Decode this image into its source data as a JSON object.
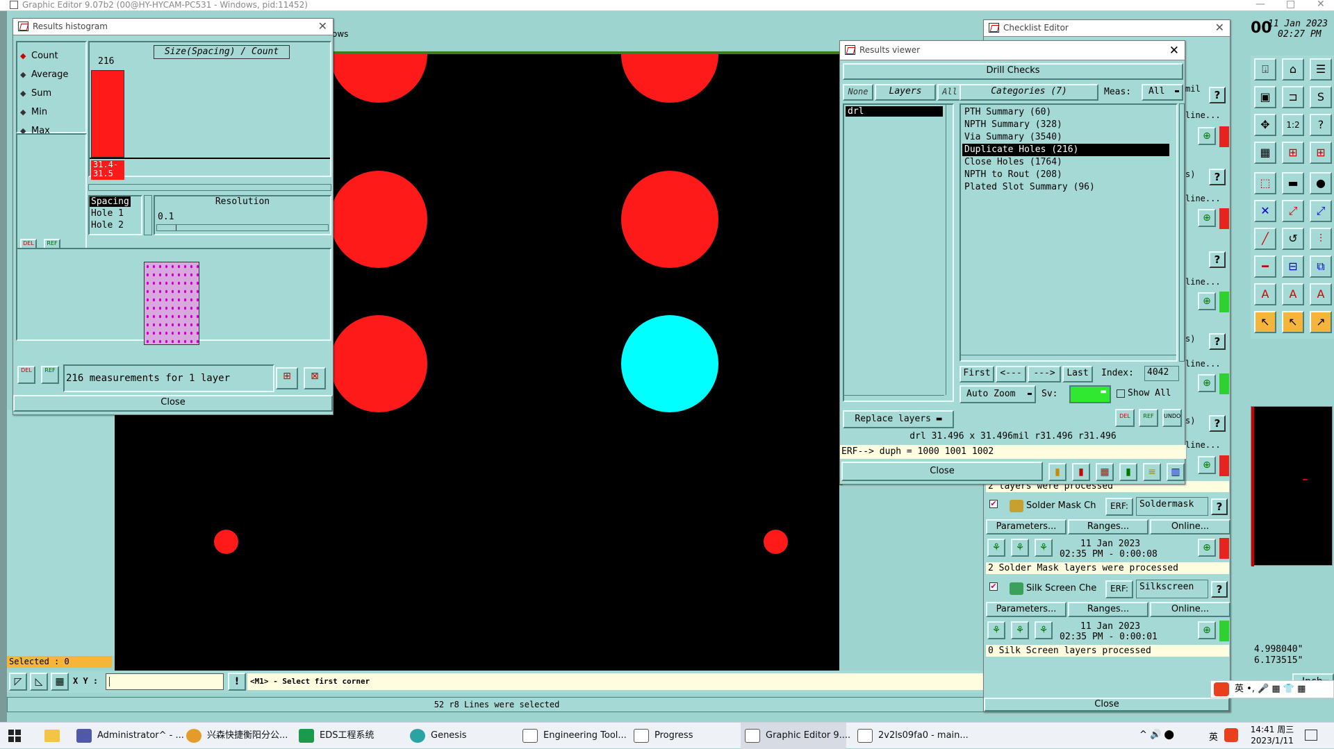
{
  "app_title": "Graphic Editor 9.07b2 (00@HY-HYCAM-PC531 - Windows, pid:11452)",
  "datetime": {
    "date": "11 Jan 2023",
    "time": "02:27 PM",
    "partial": "00"
  },
  "main_menu_partial": "ows",
  "histogram": {
    "title": "Results histogram",
    "options": [
      "Count",
      "Average",
      "Sum",
      "Min",
      "Max"
    ],
    "selected_option": "Count",
    "axis_title": "Size(Spacing) / Count",
    "bar_count": "216",
    "bar_label": "31.4- 31.5",
    "spacing_header": "Spacing",
    "spacing_items": [
      "Hole 1",
      "Hole 2"
    ],
    "resolution_label": "Resolution",
    "resolution_value": "0.1",
    "summary": "216 measurements for 1 layer",
    "close": "Close",
    "del": "DEL",
    "ref": "REF",
    "chart_data": {
      "type": "bar",
      "categories": [
        "31.4-31.5"
      ],
      "values": [
        216
      ],
      "title": "Size(Spacing) / Count",
      "xlabel": "",
      "ylabel": ""
    }
  },
  "results_viewer": {
    "title": "Results viewer",
    "section": "Drill Checks",
    "layer_tabs": [
      "None",
      "Layers",
      "All"
    ],
    "layers": [
      "drl"
    ],
    "categories_header": "Categories (7)",
    "meas_label": "Meas:",
    "meas_value": "All",
    "categories": [
      "PTH Summary (60)",
      "NPTH Summary (328)",
      "Via Summary (3540)",
      "Duplicate Holes (216)",
      "Close Holes (1764)",
      "NPTH to Rout (208)",
      "Plated Slot Summary (96)"
    ],
    "selected_category": "Duplicate Holes (216)",
    "nav": {
      "first": "First",
      "prev": "<---",
      "next": "--->",
      "last": "Last",
      "index_label": "Index:",
      "index_value": "4042"
    },
    "auto_zoom": "Auto Zoom",
    "sv_label": "Sv:",
    "show_all": "Show All",
    "replace_layers": "Replace layers",
    "info_line": "drl 31.496 x 31.496mil  r31.496  r31.496",
    "erf_line": "ERF--> duph = 1000 1001 1002",
    "close": "Close"
  },
  "checklist": {
    "title": "Checklist Editor",
    "partial_labels": [
      "mil",
      "line...",
      "s)",
      "line...",
      "line...",
      "s)",
      "line...",
      "s)",
      "line..."
    ],
    "processed_partial": "2 layers were processed",
    "items": [
      {
        "name": "Solder Mask Ch",
        "erf_label": "ERF:",
        "erf_value": "Soldermask",
        "params": "Parameters...",
        "ranges": "Ranges...",
        "online": "Online...",
        "date": "11 Jan 2023",
        "time": "02:35 PM - 0:00:08",
        "status": "2 Solder Mask layers were processed"
      },
      {
        "name": "Silk Screen Che",
        "erf_label": "ERF:",
        "erf_value": "Silkscreen",
        "params": "Parameters...",
        "ranges": "Ranges...",
        "online": "Online...",
        "date": "11 Jan 2023",
        "time": "02:35 PM - 0:00:01",
        "status": "0 Silk Screen layers processed"
      }
    ],
    "close": "Close"
  },
  "coords": {
    "x": "4.998040\"",
    "y": "6.173515\""
  },
  "units": "Inch",
  "selected_status": "Selected : 0",
  "xy_label": "X Y :",
  "xy_value": "",
  "prompt": "<M1> - Select first corner",
  "status_line": "52 r8 Lines were selected",
  "taskbar": {
    "items": [
      "Administrator^ - ...",
      "兴森快捷衡阳分公...",
      "EDS工程系统",
      "Genesis",
      "Engineering Tool...",
      "Progress",
      "Graphic Editor 9....",
      "2v2ls09fa0 - main..."
    ],
    "clock_time": "14:41 周三",
    "clock_date": "2023/1/11",
    "ime": "英"
  },
  "colors": {
    "teal": "#a5d9d5",
    "red": "#ff1a1a",
    "cyan": "#00ffff",
    "magenta": "#ff00ff",
    "yellow_status": "#f5b53a",
    "cream": "#fffde0"
  }
}
